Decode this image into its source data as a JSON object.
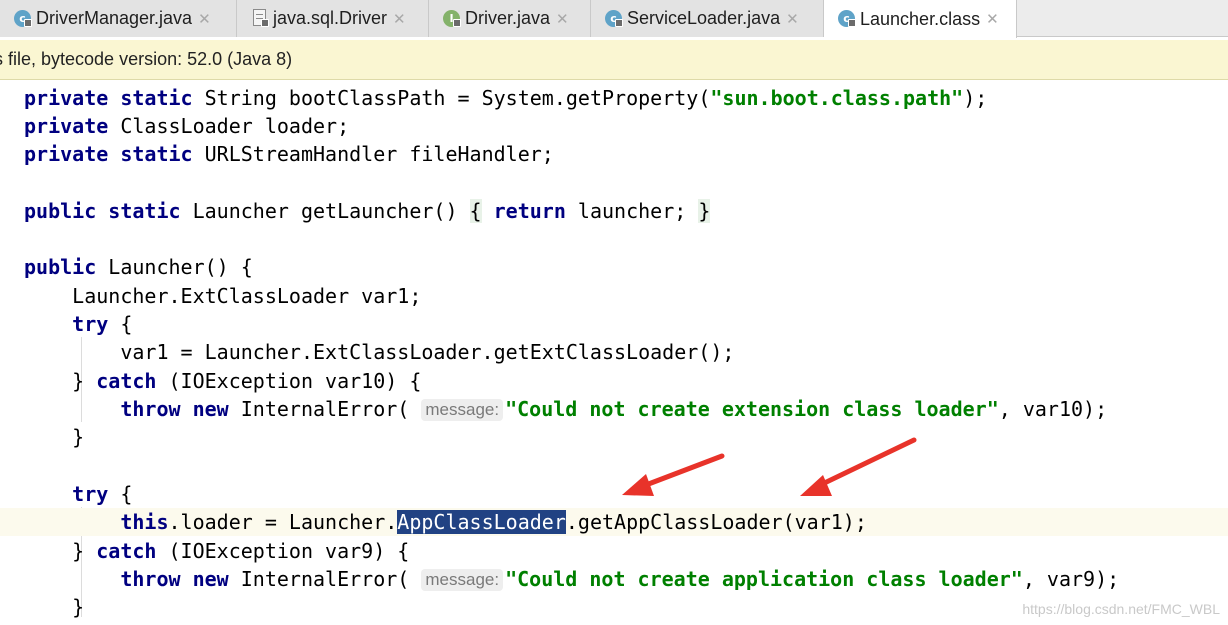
{
  "tabs": [
    {
      "label": "DriverManager.java",
      "icon": "class-icon",
      "locked": true,
      "active": false
    },
    {
      "label": "java.sql.Driver",
      "icon": "file-icon",
      "locked": true,
      "active": false
    },
    {
      "label": "Driver.java",
      "icon": "interface-icon",
      "locked": true,
      "active": false
    },
    {
      "label": "ServiceLoader.java",
      "icon": "class-icon",
      "locked": true,
      "active": false
    },
    {
      "label": "Launcher.class",
      "icon": "class-icon",
      "locked": true,
      "active": true
    }
  ],
  "tab_close_glyph": "✕",
  "banner": {
    "text": "s file, bytecode version: 52.0 (Java 8)"
  },
  "code": {
    "lines": [
      [
        [
          "private",
          "kw"
        ],
        [
          " ",
          ""
        ],
        [
          "static",
          "kw"
        ],
        [
          " String bootClassPath = System.getProperty(",
          ""
        ],
        [
          "\"sun.boot.class.path\"",
          "str"
        ],
        [
          ");",
          ""
        ]
      ],
      [
        [
          "private",
          "kw"
        ],
        [
          " ClassLoader loader;",
          ""
        ]
      ],
      [
        [
          "private",
          "kw"
        ],
        [
          " ",
          ""
        ],
        [
          "static",
          "kw"
        ],
        [
          " URLStreamHandler fileHandler;",
          ""
        ]
      ],
      [],
      [
        [
          "public",
          "kw"
        ],
        [
          " ",
          ""
        ],
        [
          "static",
          "kw"
        ],
        [
          " Launcher getLauncher() ",
          ""
        ],
        [
          "{",
          "fold"
        ],
        [
          " ",
          ""
        ],
        [
          "return",
          "kw"
        ],
        [
          " launcher; ",
          ""
        ],
        [
          "}",
          "fold"
        ]
      ],
      [],
      [
        [
          "public",
          "kw"
        ],
        [
          " Launcher() {",
          ""
        ]
      ],
      [
        [
          "    Launcher.ExtClassLoader var1;",
          ""
        ]
      ],
      [
        [
          "    ",
          ""
        ],
        [
          "try",
          "kw"
        ],
        [
          " {",
          ""
        ]
      ],
      [
        [
          "        var1 = Launcher.ExtClassLoader.getExtClassLoader();",
          ""
        ]
      ],
      [
        [
          "    } ",
          ""
        ],
        [
          "catch",
          "kw"
        ],
        [
          " (IOException var10) {",
          ""
        ]
      ],
      [
        [
          "        ",
          ""
        ],
        [
          "throw",
          "kw"
        ],
        [
          " ",
          ""
        ],
        [
          "new",
          "kw"
        ],
        [
          " InternalError( ",
          ""
        ],
        [
          "message:",
          "hint"
        ],
        [
          "\"Could not create extension class loader\"",
          "str"
        ],
        [
          ", var10);",
          ""
        ]
      ],
      [
        [
          "    }",
          ""
        ]
      ],
      [],
      [
        [
          "    ",
          ""
        ],
        [
          "try",
          "kw"
        ],
        [
          " {",
          ""
        ]
      ],
      [
        [
          "        ",
          ""
        ],
        [
          "this",
          "kw"
        ],
        [
          ".loader = Launcher.",
          ""
        ],
        [
          "AppClassLoader",
          "sel"
        ],
        [
          ".getAppClassLoader(var1);",
          ""
        ]
      ],
      [
        [
          "    } ",
          ""
        ],
        [
          "catch",
          "kw"
        ],
        [
          " (IOException var9) {",
          ""
        ]
      ],
      [
        [
          "        ",
          ""
        ],
        [
          "throw",
          "kw"
        ],
        [
          " ",
          ""
        ],
        [
          "new",
          "kw"
        ],
        [
          " InternalError( ",
          ""
        ],
        [
          "message:",
          "hint"
        ],
        [
          "\"Could not create application class loader\"",
          "str"
        ],
        [
          ", var9);",
          ""
        ]
      ],
      [
        [
          "    }",
          ""
        ]
      ]
    ]
  },
  "colors": {
    "keyword": "#000080",
    "string": "#008000",
    "selection": "#214283",
    "arrow": "#e8332a",
    "class_icon": "#5fa3c8",
    "interface_icon": "#84b26a"
  },
  "watermark": "https://blog.csdn.net/FMC_WBL"
}
